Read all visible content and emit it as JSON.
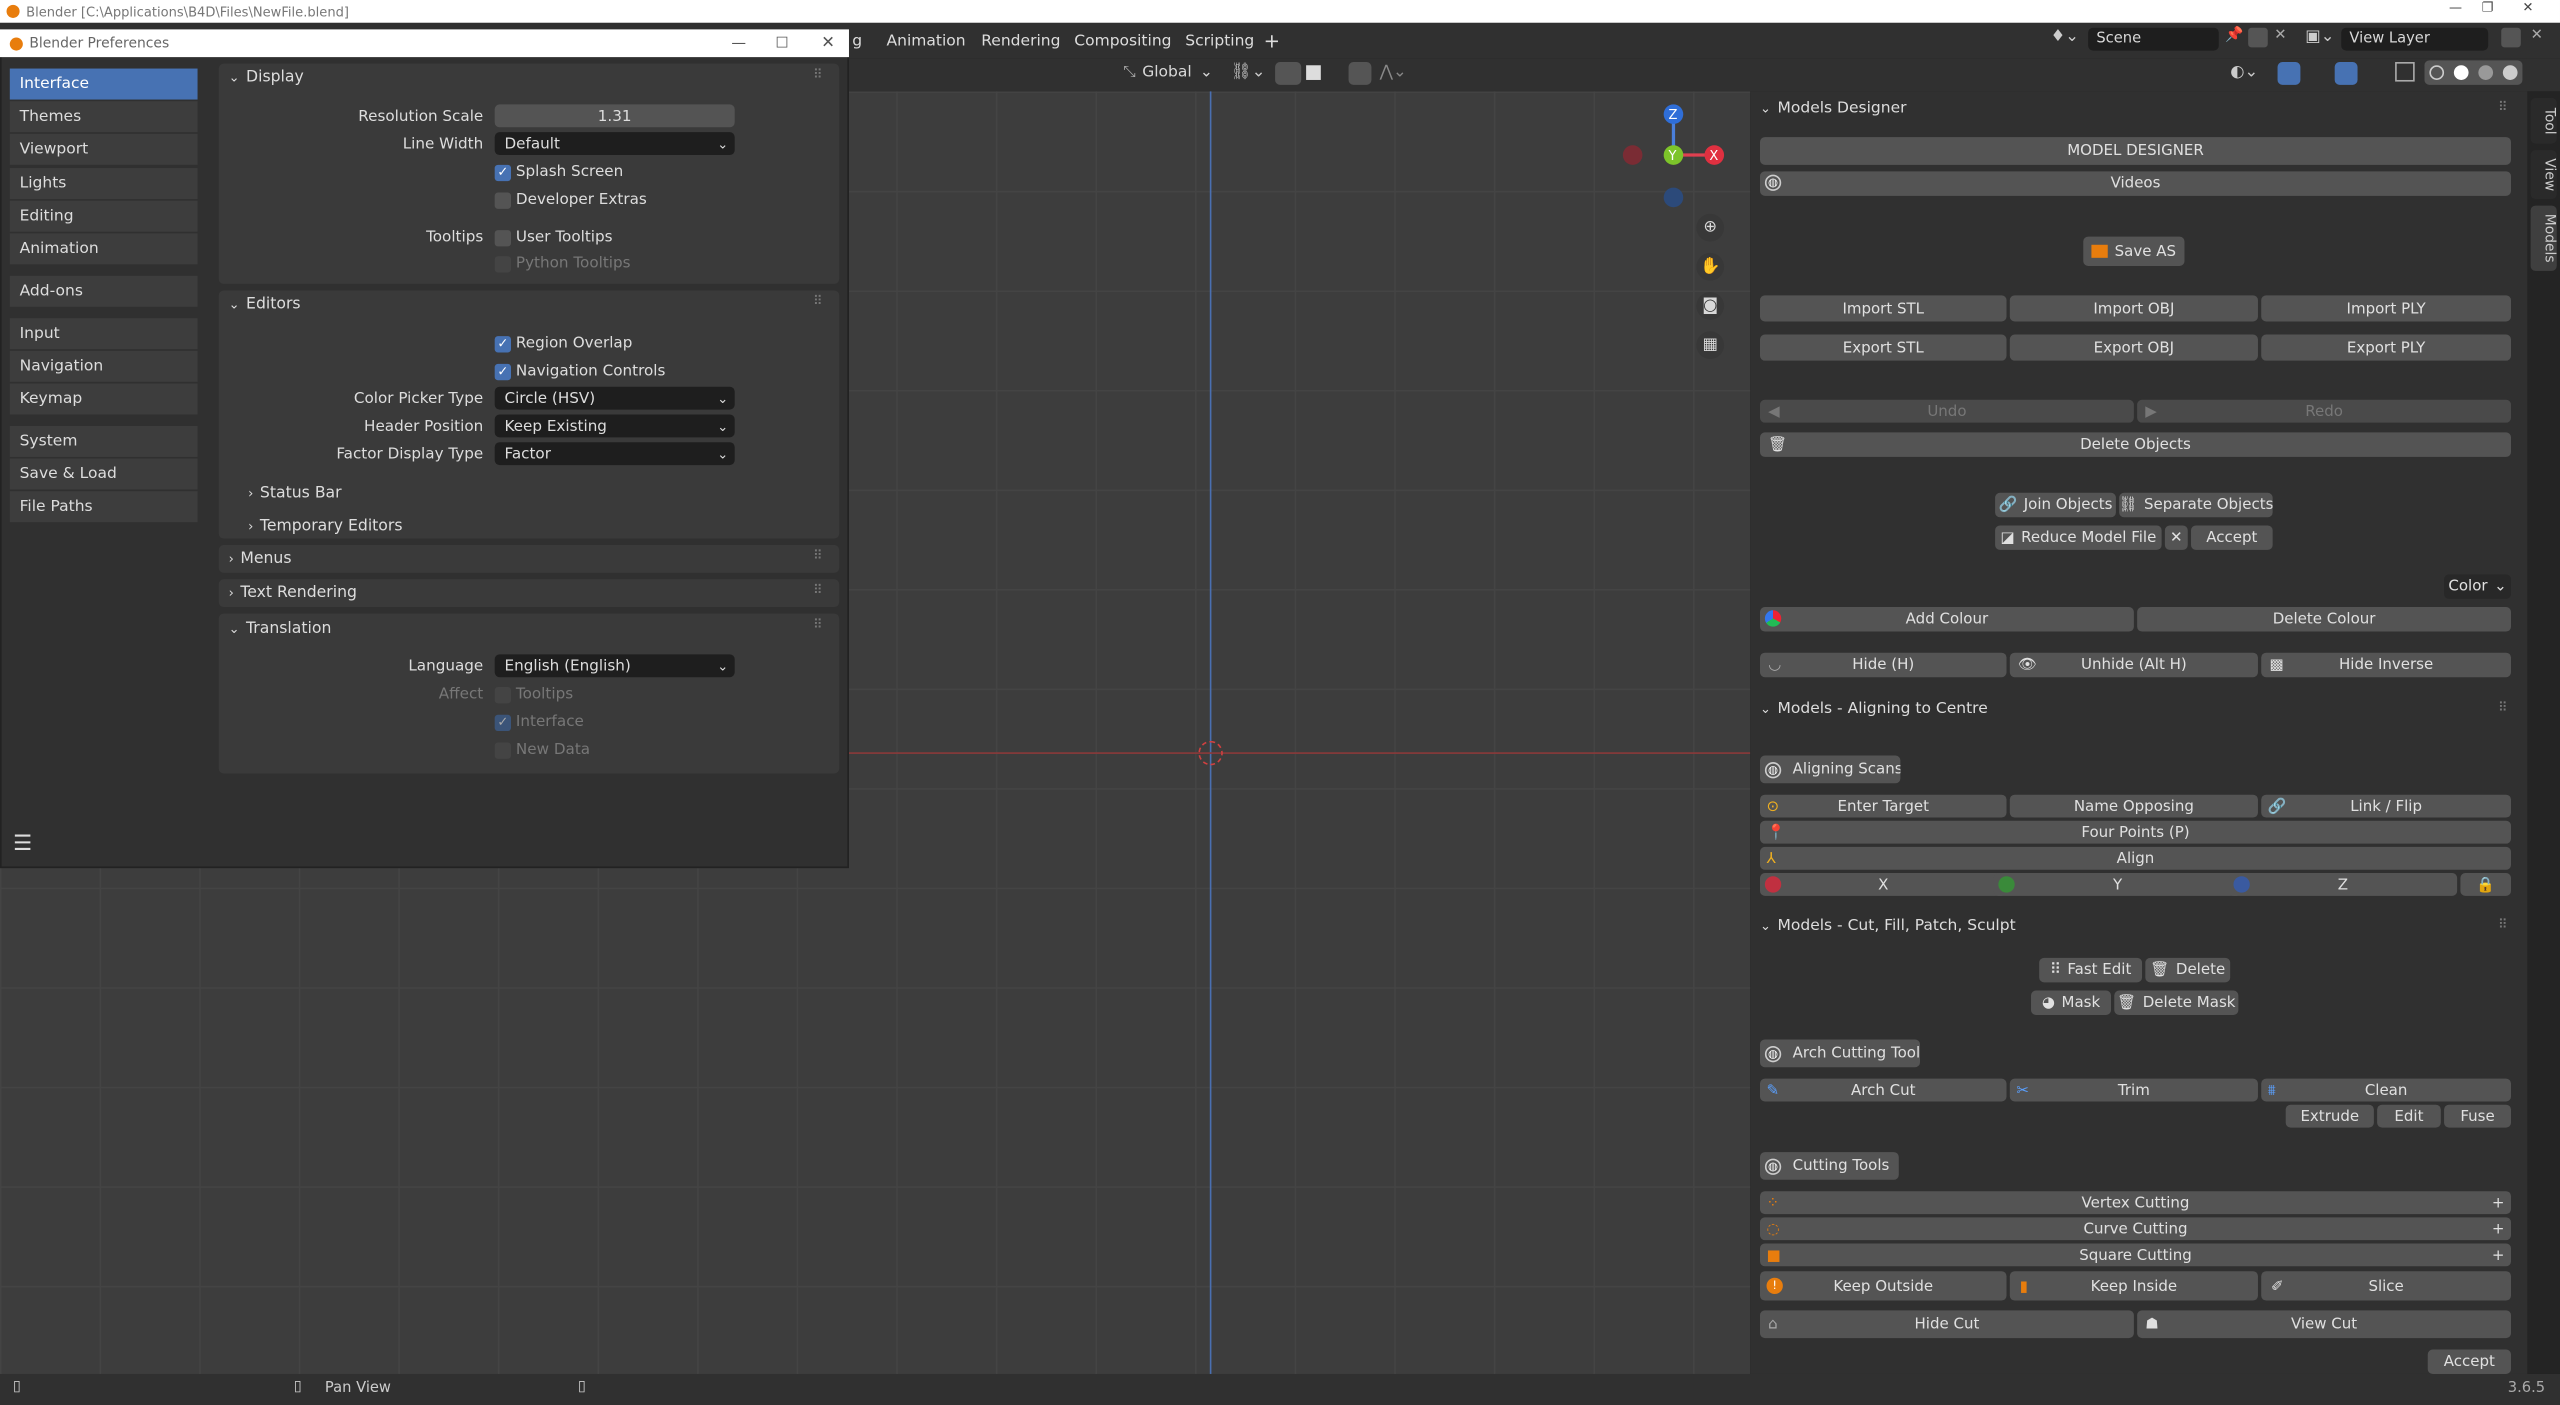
{
  "window": {
    "title": "Blender [C:\\Applications\\B4D\\Files\\NewFile.blend]",
    "version": "3.6.5"
  },
  "topbar": {
    "tabs": [
      "g",
      "Animation",
      "Rendering",
      "Compositing",
      "Scripting",
      "+"
    ],
    "scene_label": "Scene",
    "view_layer_label": "View Layer"
  },
  "viewport_header": {
    "orientation": "Global"
  },
  "status_bar": {
    "pan_view": "Pan View"
  },
  "side_tabs": [
    "Tool",
    "View",
    "Models"
  ],
  "models_designer": {
    "header": "Models Designer",
    "title_button": "MODEL DESIGNER",
    "videos": "Videos",
    "save_as": "Save AS",
    "import_stl": "Import STL",
    "import_obj": "Import OBJ",
    "import_ply": "Import PLY",
    "export_stl": "Export STL",
    "export_obj": "Export OBJ",
    "export_ply": "Export PLY",
    "undo": "Undo",
    "redo": "Redo",
    "delete_objects": "Delete Objects",
    "join_objects": "Join Objects",
    "separate_objects": "Separate Objects",
    "reduce_model_file": "Reduce Model File",
    "accept": "Accept",
    "color_dropdown": "Color",
    "add_colour": "Add Colour",
    "delete_colour": "Delete Colour",
    "hide": "Hide (H)",
    "unhide": "Unhide (Alt H)",
    "hide_inverse": "Hide Inverse"
  },
  "aligning": {
    "header": "Models - Aligning to Centre",
    "aligning_scans": "Aligning Scans",
    "enter_target": "Enter Target",
    "name_opposing": "Name Opposing",
    "link_flip": "Link / Flip",
    "four_points": "Four Points (P)",
    "align": "Align",
    "x": "X",
    "y": "Y",
    "z": "Z"
  },
  "cutting": {
    "header": "Models - Cut, Fill, Patch, Sculpt",
    "fast_edit": "Fast Edit",
    "delete": "Delete",
    "mask": "Mask",
    "delete_mask": "Delete Mask",
    "arch_cutting_tool": "Arch Cutting Tool",
    "arch_cut": "Arch Cut",
    "trim": "Trim",
    "clean": "Clean",
    "extrude": "Extrude",
    "edit": "Edit",
    "fuse": "Fuse",
    "cutting_tools": "Cutting Tools",
    "vertex_cutting": "Vertex Cutting",
    "curve_cutting": "Curve Cutting",
    "square_cutting": "Square Cutting",
    "keep_outside": "Keep Outside",
    "keep_inside": "Keep Inside",
    "slice": "Slice",
    "hide_cut": "Hide Cut",
    "view_cut": "View Cut",
    "accept": "Accept"
  },
  "prefs": {
    "title": "Blender Preferences",
    "sidebar": [
      "Interface",
      "Themes",
      "Viewport",
      "Lights",
      "Editing",
      "Animation",
      "Add-ons",
      "Input",
      "Navigation",
      "Keymap",
      "System",
      "Save & Load",
      "File Paths"
    ],
    "display": {
      "header": "Display",
      "resolution_scale_label": "Resolution Scale",
      "resolution_scale": "1.31",
      "line_width_label": "Line Width",
      "line_width": "Default",
      "splash_screen": "Splash Screen",
      "developer_extras": "Developer Extras",
      "tooltips_label": "Tooltips",
      "user_tooltips": "User Tooltips",
      "python_tooltips": "Python Tooltips"
    },
    "editors": {
      "header": "Editors",
      "region_overlap": "Region Overlap",
      "navigation_controls": "Navigation Controls",
      "color_picker_label": "Color Picker Type",
      "color_picker": "Circle (HSV)",
      "header_position_label": "Header Position",
      "header_position": "Keep Existing",
      "factor_display_label": "Factor Display Type",
      "factor_display": "Factor",
      "status_bar": "Status Bar",
      "temporary_editors": "Temporary Editors"
    },
    "menus": "Menus",
    "text_rendering": "Text Rendering",
    "translation": {
      "header": "Translation",
      "language_label": "Language",
      "language": "English (English)",
      "affect_label": "Affect",
      "tooltips": "Tooltips",
      "interface": "Interface",
      "new_data": "New Data"
    }
  }
}
